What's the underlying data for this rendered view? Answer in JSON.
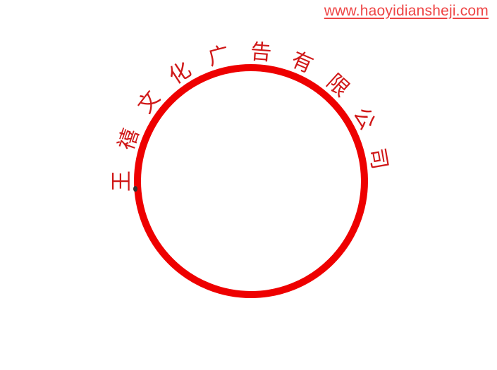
{
  "watermark": {
    "text": "www.haoyidiansheji.com"
  },
  "seal": {
    "arc_text": [
      "王",
      "禧",
      "文",
      "化",
      "广",
      "告",
      "有",
      "限",
      "公",
      "司"
    ],
    "ring_color": "#ee0000",
    "text_color": "#d01818",
    "watermark_color": "#ee4444"
  }
}
